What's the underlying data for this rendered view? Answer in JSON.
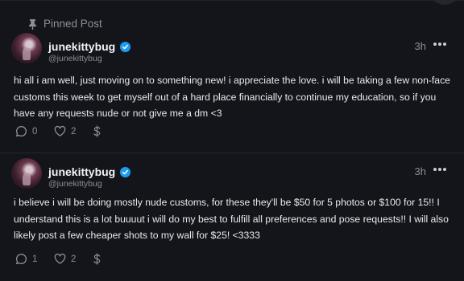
{
  "pinned_label": "Pinned Post",
  "accent_color": "#1d9bf0",
  "posts": [
    {
      "username": "junekittybug",
      "handle": "@junekittybug",
      "time": "3h",
      "text": "hi all i am well, just moving on to something new! i appreciate the love. i will be taking a few non-face customs this week to get myself out of a hard place financially to continue my education, so if you have any requests nude or not give me a dm <3",
      "comments": "0",
      "likes": "2"
    },
    {
      "username": "junekittybug",
      "handle": "@junekittybug",
      "time": "3h",
      "text": "i believe i will be doing mostly nude customs, for these they'll be $50 for 5 photos or $100 for 15!! I understand this is a lot buuuut i will do my best to fulfill all preferences and pose requests!! I will also likely post a few cheaper shots to my wall for $25! <3333",
      "comments": "1",
      "likes": "2"
    }
  ]
}
